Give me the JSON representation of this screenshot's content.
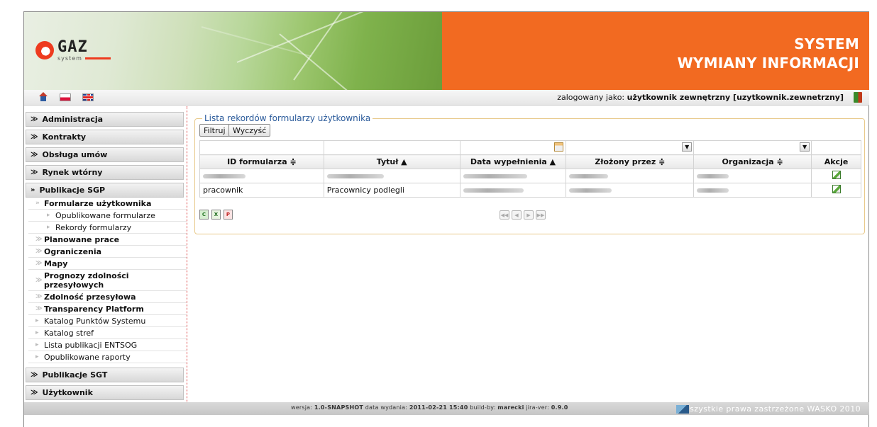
{
  "header": {
    "title_line1": "SYSTEM",
    "title_line2": "WYMIANY INFORMACJI",
    "logo_text": "GAZ",
    "logo_sub": "system"
  },
  "toolbar": {
    "login_prefix": "zalogowany jako:",
    "login_user": "użytkownik zewnętrzny [uzytkownik.zewnetrzny]"
  },
  "sidebar": {
    "sections": [
      {
        "label": "Administracja"
      },
      {
        "label": "Kontrakty"
      },
      {
        "label": "Obsługa umów"
      },
      {
        "label": "Rynek wtórny"
      },
      {
        "label": "Publikacje SGP"
      }
    ],
    "sgp_items": [
      {
        "label": "Formularze użytkownika"
      },
      {
        "label": "Opublikowane formularze"
      },
      {
        "label": "Rekordy formularzy"
      },
      {
        "label": "Planowane prace"
      },
      {
        "label": "Ograniczenia"
      },
      {
        "label": "Mapy"
      },
      {
        "label": "Prognozy zdolności przesyłowych"
      },
      {
        "label": "Zdolność przesyłowa"
      },
      {
        "label": "Transparency Platform"
      },
      {
        "label": "Katalog Punktów Systemu"
      },
      {
        "label": "Katalog stref"
      },
      {
        "label": "Lista publikacji ENTSOG"
      },
      {
        "label": "Opublikowane raporty"
      }
    ],
    "bottom_sections": [
      {
        "label": "Publikacje SGT"
      },
      {
        "label": "Użytkownik"
      }
    ]
  },
  "main": {
    "legend": "Lista rekordów formularzy użytkownika",
    "filter_button": "Filtruj",
    "clear_button": "Wyczyść",
    "columns": [
      "ID formularza ≑",
      "Tytuł ▲",
      "Data wypełnienia ▲",
      "Złożony przez ≑",
      "Organizacja ≑",
      "Akcje"
    ],
    "rows": [
      {
        "id": "",
        "title": "",
        "date": "",
        "by": "",
        "org": ""
      },
      {
        "id": "pracownik",
        "title": "Pracownicy podlegli",
        "date": "",
        "by": "",
        "org": ""
      }
    ]
  },
  "footer": {
    "copyright": "szystkie prawa zastrzeżone WASKO 2010",
    "version_label": "wersja:",
    "version": "1.0-SNAPSHOT",
    "date_label": "data wydania:",
    "date": "2011-02-21 15:40",
    "build_label": "build-by:",
    "build": "marecki",
    "jira_label": "jira-ver:",
    "jira": "0.9.0"
  },
  "colors": {
    "brand_orange": "#f26a21",
    "legend_blue": "#2a5a9a"
  }
}
